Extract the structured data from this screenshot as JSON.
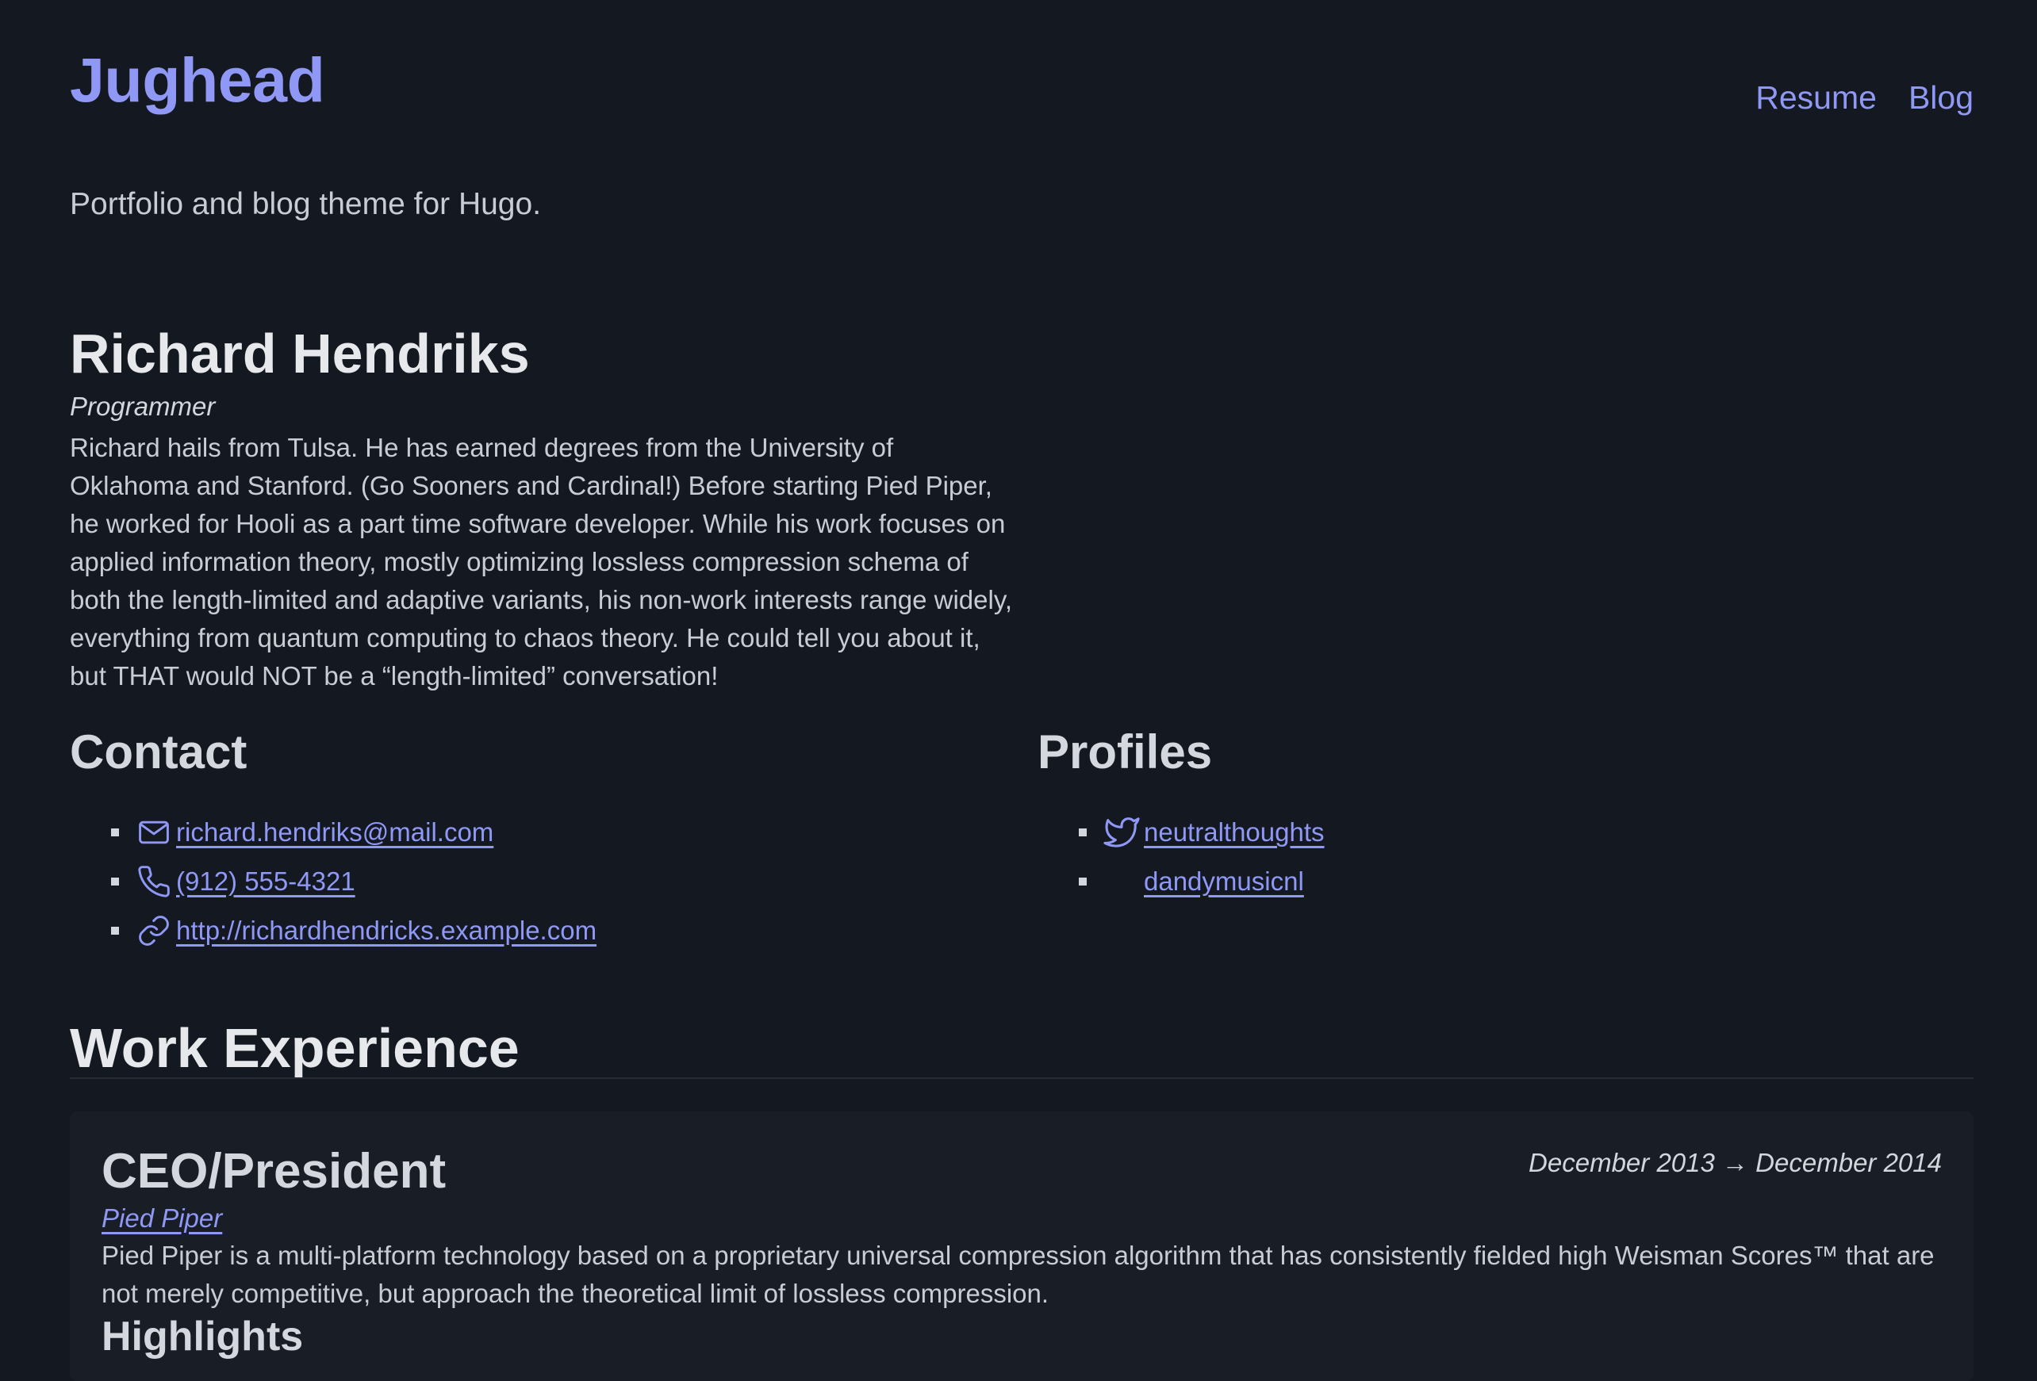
{
  "site": {
    "title": "Jughead",
    "tagline": "Portfolio and blog theme for Hugo."
  },
  "nav": [
    {
      "label": "Resume"
    },
    {
      "label": "Blog"
    }
  ],
  "person": {
    "name": "Richard Hendriks",
    "role": "Programmer",
    "bio": "Richard hails from Tulsa. He has earned degrees from the University of Oklahoma and Stanford. (Go Sooners and Cardinal!) Before starting Pied Piper, he worked for Hooli as a part time software developer. While his work focuses on applied information theory, mostly optimizing lossless compression schema of both the length-limited and adaptive variants, his non-work interests range widely, everything from quantum computing to chaos theory. He could tell you about it, but THAT would NOT be a “length-limited” conversation!"
  },
  "contact": {
    "heading": "Contact",
    "items": [
      {
        "icon": "mail-icon",
        "text": "richard.hendriks@mail.com"
      },
      {
        "icon": "phone-icon",
        "text": "(912) 555-4321"
      },
      {
        "icon": "link-icon",
        "text": "http://richardhendricks.example.com"
      }
    ]
  },
  "profiles": {
    "heading": "Profiles",
    "items": [
      {
        "icon": "twitter-icon",
        "text": "neutralthoughts"
      },
      {
        "icon": "",
        "text": "dandymusicnl"
      }
    ]
  },
  "work": {
    "heading": "Work Experience",
    "jobs": [
      {
        "title": "CEO/President",
        "company": "Pied Piper",
        "dates": "December 2013 → December 2014",
        "summary": "Pied Piper is a multi-platform technology based on a proprietary universal compression algorithm that has consistently fielded high Weisman Scores™ that are not merely competitive, but approach the theoretical limit of lossless compression.",
        "highlights_heading": "Highlights"
      }
    ]
  },
  "colors": {
    "background": "#141821",
    "accent": "#8f99f5",
    "card": "#191d26"
  }
}
